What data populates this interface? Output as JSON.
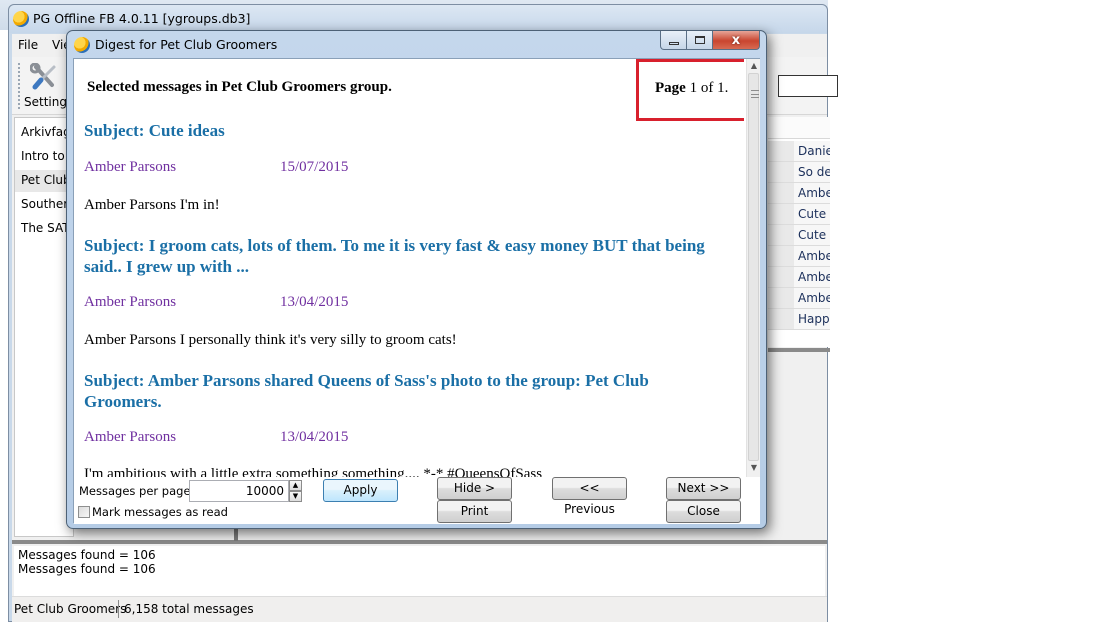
{
  "main_window": {
    "title": "PG Offline FB 4.0.11  [ygroups.db3]",
    "menu": [
      "File",
      "Vie"
    ],
    "toolbar": {
      "settings_label": "Settings"
    },
    "groups": [
      {
        "label": "Arkivfagl",
        "selected": false
      },
      {
        "label": "Intro to I",
        "selected": false
      },
      {
        "label": "Pet Club",
        "selected": true
      },
      {
        "label": "Southern",
        "selected": false
      },
      {
        "label": "The SATC",
        "selected": false
      }
    ],
    "message_rows": [
      "Danie",
      "So de",
      "Ambe",
      "Cute",
      "Cute",
      "Ambe",
      "Ambe",
      "Ambe",
      "Happ"
    ],
    "log": [
      "Messages found = 106",
      "Messages found = 106"
    ],
    "status": {
      "group": "Pet Club Groomers",
      "total": "6,158 total messages"
    }
  },
  "dialog": {
    "title": "Digest for Pet Club Groomers",
    "caption_buttons": {
      "minimize": "minimize",
      "maximize": "maximize",
      "close": "x"
    },
    "heading": "Selected messages in Pet Club Groomers group.",
    "page": {
      "word": "Page",
      "current": "1",
      "of_word": "of",
      "total": "1."
    },
    "messages": [
      {
        "subject": "Subject: Cute ideas",
        "author": "Amber Parsons",
        "date": "15/07/2015",
        "body": "Amber Parsons I'm in!"
      },
      {
        "subject": "Subject: I groom cats, lots of them. To me it is very fast & easy money BUT that being said.. I grew up with ...",
        "author": "Amber Parsons",
        "date": "13/04/2015",
        "body": "Amber Parsons I personally think it's very silly to groom cats!"
      },
      {
        "subject": "Subject: Amber Parsons shared Queens of Sass's photo to the group: Pet Club Groomers.",
        "author": "Amber Parsons",
        "date": "13/04/2015",
        "body": "I'm ambitious with a little extra something something.... *-* #QueensOfSass"
      }
    ],
    "controls": {
      "messages_per_page_label": "Messages per page",
      "messages_per_page_value": "10000",
      "apply": "Apply",
      "mark_read_label": "Mark messages as read",
      "mark_read_checked": false,
      "hide": "Hide >",
      "print": "Print",
      "previous": "<< Previous",
      "next": "Next >>",
      "close": "Close"
    }
  },
  "colors": {
    "subject": "#1a6fa6",
    "author": "#7030a0",
    "highlight_box": "#d8202d"
  }
}
